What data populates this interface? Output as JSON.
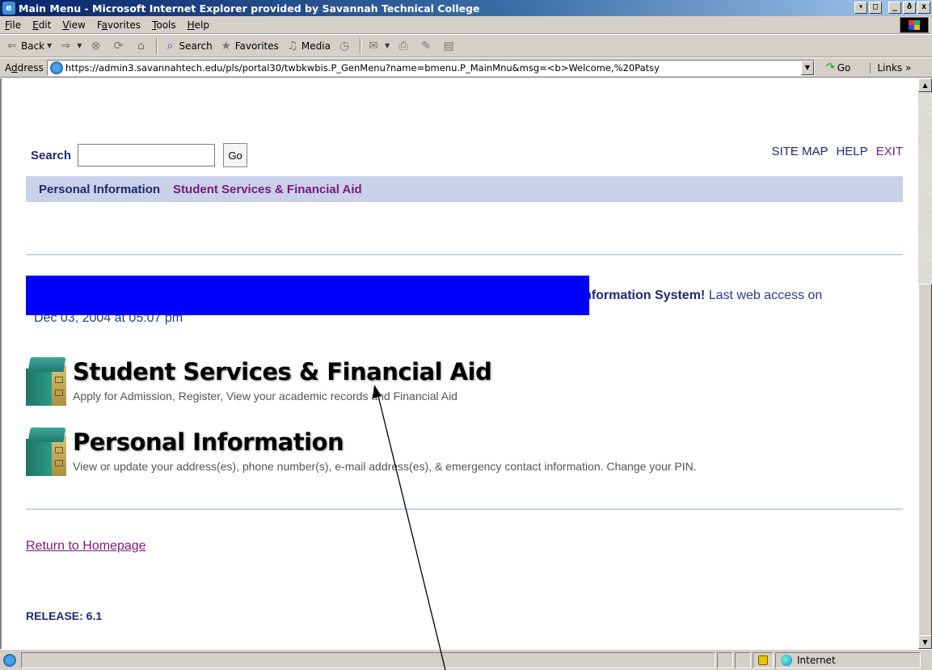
{
  "window": {
    "title": "Main Menu - Microsoft Internet Explorer provided by Savannah Technical College",
    "controls": [
      "_",
      "□",
      "_",
      "ð",
      "x"
    ]
  },
  "menubar": {
    "items": [
      {
        "label": "File",
        "underline": "F",
        "rest": "ile"
      },
      {
        "label": "Edit",
        "underline": "E",
        "rest": "dit"
      },
      {
        "label": "View",
        "underline": "V",
        "rest": "iew"
      },
      {
        "label": "Favorites",
        "underline": "a",
        "pre": "F",
        "rest": "vorites"
      },
      {
        "label": "Tools",
        "underline": "T",
        "rest": "ools"
      },
      {
        "label": "Help",
        "underline": "H",
        "rest": "elp"
      }
    ]
  },
  "toolbar": {
    "back": "Back",
    "search": "Search",
    "favorites": "Favorites",
    "media": "Media"
  },
  "addressbar": {
    "label": "Address",
    "label_underline": "d",
    "url": "https://admin3.savannahtech.edu/pls/portal30/twbkwbis.P_GenMenu?name=bmenu.P_MainMnu&msg=<b>Welcome,%20Patsy",
    "go": "Go",
    "links": "Links »"
  },
  "page": {
    "search_label": "Search",
    "search_value": "",
    "go_button": "Go",
    "top_links": [
      "SITE MAP",
      "HELP",
      "EXIT"
    ],
    "nav": {
      "personal": "Personal Information",
      "student": "Student Services & Financial Aid"
    },
    "welcome": {
      "bold": "nformation System!",
      "rest": " Last web access on",
      "line2": "Dec 03, 2004 at 05:07 pm"
    },
    "entries": [
      {
        "title": "Student Services & Financial Aid",
        "desc": "Apply for Admission, Register, View your academic records and Financial Aid"
      },
      {
        "title": "Personal Information",
        "desc": "View or update your address(es), phone number(s), e-mail address(es), & emergency contact information. Change your PIN."
      }
    ],
    "return_link": "Return to Homepage",
    "release": "RELEASE: 6.1"
  },
  "statusbar": {
    "zone": "Internet"
  },
  "colors": {
    "nav_bg": "#c9d1ea",
    "link_dark": "#1b2b6b",
    "link_visited": "#7a1a7a",
    "redaction": "#0000ff"
  }
}
